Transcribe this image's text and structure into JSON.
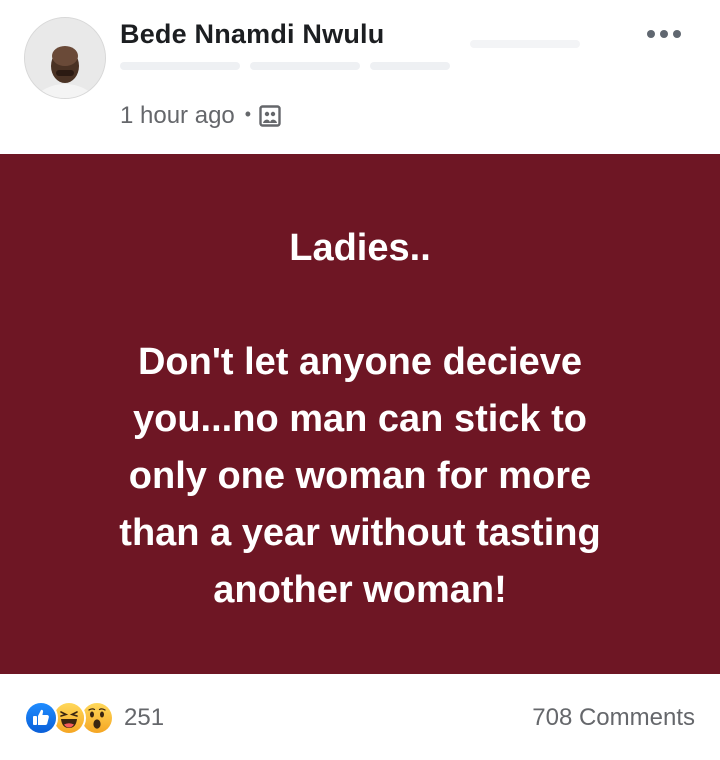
{
  "post": {
    "author": {
      "name": "Bede Nnamdi Nwulu"
    },
    "timestamp": "1 hour ago",
    "separator": "•",
    "audience_icon": "photo-album-icon",
    "more_icon": "more-options-icon",
    "content": {
      "heading": "Ladies..",
      "lines": [
        "Don't let anyone decieve",
        "you...no man can stick to",
        "only one woman for more",
        "than a year without tasting",
        "another woman!"
      ],
      "background_color": "#6e1624",
      "text_color": "#ffffff"
    },
    "reactions": {
      "types": [
        "like-icon",
        "haha-icon",
        "wow-icon"
      ],
      "count": "251"
    },
    "comments": {
      "label": "708 Comments"
    }
  }
}
